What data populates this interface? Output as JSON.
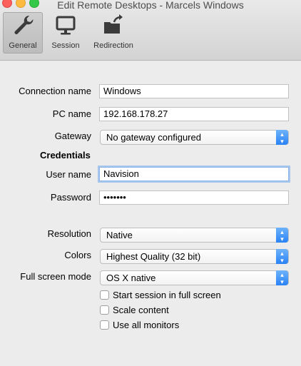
{
  "window": {
    "title": "Edit Remote Desktops - Marcels Windows"
  },
  "toolbar": {
    "tabs": [
      {
        "label": "General",
        "icon": "wrench-icon",
        "selected": true
      },
      {
        "label": "Session",
        "icon": "monitor-icon",
        "selected": false
      },
      {
        "label": "Redirection",
        "icon": "folder-share-icon",
        "selected": false
      }
    ]
  },
  "form": {
    "connection_name": {
      "label": "Connection name",
      "value": "Windows"
    },
    "pc_name": {
      "label": "PC name",
      "value": "192.168.178.27"
    },
    "gateway": {
      "label": "Gateway",
      "value": "No gateway configured"
    },
    "credentials_heading": "Credentials",
    "user_name": {
      "label": "User name",
      "value": "Navision"
    },
    "password": {
      "label": "Password",
      "value": "•••••••"
    },
    "resolution": {
      "label": "Resolution",
      "value": "Native"
    },
    "colors": {
      "label": "Colors",
      "value": "Highest Quality (32 bit)"
    },
    "full_screen_mode": {
      "label": "Full screen mode",
      "value": "OS X native"
    },
    "checkboxes": [
      {
        "label": "Start session in full screen",
        "checked": false
      },
      {
        "label": "Scale content",
        "checked": false
      },
      {
        "label": "Use all monitors",
        "checked": false
      }
    ]
  },
  "colors": {
    "accent": "#2a82f6",
    "focus_ring": "#a7c6ee"
  }
}
